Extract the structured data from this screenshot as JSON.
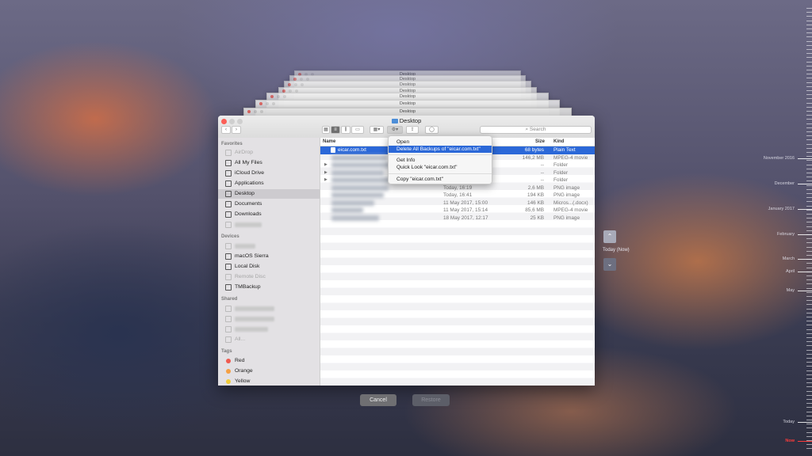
{
  "finder": {
    "window_title": "Desktop",
    "ghost_titles": [
      "Desktop",
      "Desktop",
      "Desktop",
      "Desktop",
      "Desktop",
      "Desktop",
      "Desktop"
    ],
    "search_placeholder": "Search",
    "sidebar": {
      "favorites_header": "Favorites",
      "favorites": [
        {
          "label": "AirDrop",
          "dim": true,
          "icon": "airdrop-icon"
        },
        {
          "label": "All My Files",
          "icon": "all-files-icon"
        },
        {
          "label": "iCloud Drive",
          "icon": "cloud-icon"
        },
        {
          "label": "Applications",
          "icon": "applications-icon"
        },
        {
          "label": "Desktop",
          "selected": true,
          "icon": "desktop-icon"
        },
        {
          "label": "Documents",
          "icon": "document-icon"
        },
        {
          "label": "Downloads",
          "icon": "download-icon"
        }
      ],
      "devices_header": "Devices",
      "devices": [
        {
          "label": "macOS Sierra",
          "icon": "disk-icon"
        },
        {
          "label": "Local Disk",
          "icon": "disk-icon"
        },
        {
          "label": "Remote Disc",
          "dim": true,
          "icon": "disc-icon"
        },
        {
          "label": "TMBackup",
          "icon": "disk-icon"
        }
      ],
      "shared_header": "Shared",
      "shared_all": "All...",
      "tags_header": "Tags",
      "tags": [
        {
          "label": "Red",
          "color": "#f05a4f"
        },
        {
          "label": "Orange",
          "color": "#f5a043"
        },
        {
          "label": "Yellow",
          "color": "#f2cc39"
        }
      ]
    },
    "columns": {
      "name": "Name",
      "size": "Size",
      "kind": "Kind"
    },
    "rows": [
      {
        "name": "eicar.com.txt",
        "date": "",
        "size": "68 bytes",
        "kind": "Plain Text",
        "selected": true
      },
      {
        "name": "",
        "date": "",
        "size": "146,2 MB",
        "kind": "MPEG-4 movie"
      },
      {
        "name": "",
        "date": "",
        "size": "--",
        "kind": "Folder",
        "folder": true
      },
      {
        "name": "",
        "date": "",
        "size": "--",
        "kind": "Folder",
        "folder": true
      },
      {
        "name": "",
        "date": "",
        "size": "--",
        "kind": "Folder",
        "folder": true
      },
      {
        "name": "",
        "date": "Today, 16:19",
        "size": "2,6 MB",
        "kind": "PNG image"
      },
      {
        "name": "",
        "date": "Today, 16:41",
        "size": "194 KB",
        "kind": "PNG image"
      },
      {
        "name": "",
        "date": "11 May 2017, 15:00",
        "size": "146 KB",
        "kind": "Micros...(.docx)"
      },
      {
        "name": "",
        "date": "11 May 2017, 15:14",
        "size": "85,6 MB",
        "kind": "MPEG-4 movie"
      },
      {
        "name": "",
        "date": "18 May 2017, 12:17",
        "size": "25 KB",
        "kind": "PNG image"
      }
    ]
  },
  "context_menu": {
    "items": [
      {
        "label": "Open"
      },
      {
        "label": "Delete All Backups of \"eicar.com.txt\"",
        "highlighted": true
      },
      {
        "label": "Get Info"
      },
      {
        "label": "Quick Look \"eicar.com.txt\""
      },
      {
        "label": "Copy \"eicar.com.txt\""
      }
    ]
  },
  "dialog": {
    "cancel": "Cancel",
    "restore": "Restore"
  },
  "nav": {
    "current_label": "Today (Now)"
  },
  "timeline": {
    "labels": [
      "November 2016",
      "December",
      "January 2017",
      "February",
      "March",
      "April",
      "May",
      "Today",
      "Now"
    ],
    "now_color": "#ff3b3b"
  }
}
